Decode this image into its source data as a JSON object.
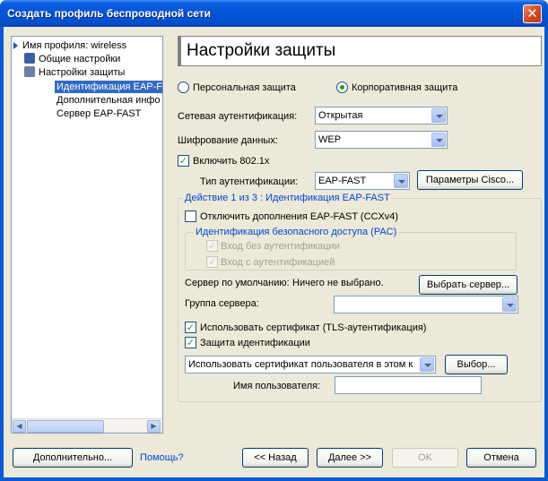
{
  "window": {
    "title": "Создать профиль беспроводной сети"
  },
  "tree": {
    "items": [
      {
        "label": "Имя профиля: wireless"
      },
      {
        "label": "Общие настройки"
      },
      {
        "label": "Настройки защиты"
      },
      {
        "label": "Идентификация EAP-F"
      },
      {
        "label": "Дополнительная инфо"
      },
      {
        "label": "Сервер EAP-FAST"
      }
    ]
  },
  "panel": {
    "title": "Настройки защиты"
  },
  "security": {
    "personal_label": "Персональная защита",
    "enterprise_label": "Корпоративная защита",
    "selected": "enterprise",
    "net_auth_label": "Сетевая аутентификация:",
    "net_auth_value": "Открытая",
    "encryption_label": "Шифрование данных:",
    "encryption_value": "WEP",
    "enable_8021x_label": "Включить 802.1x",
    "enable_8021x_checked": true,
    "auth_type_label": "Тип аутентификации:",
    "auth_type_value": "EAP-FAST",
    "cisco_params_button": "Параметры Cisco..."
  },
  "eap": {
    "group_title": "Действие 1 из 3 : Идентификация EAP-FAST",
    "disable_ccx_label": "Отключить дополнения EAP-FAST (CCXv4)",
    "disable_ccx_checked": false,
    "pac_group_title": "Идентификация безопасного доступа (PAC)",
    "pac_unauth_label": "Вход без аутентификации",
    "pac_auth_label": "Вход с аутентификацией",
    "default_server_label": "Сервер по умолчанию:",
    "default_server_value": "Ничего не выбрано.",
    "select_server_button": "Выбрать сервер...",
    "server_group_label": "Группа сервера:",
    "server_group_value": "",
    "use_cert_label": "Использовать сертификат (TLS-аутентификация)",
    "use_cert_checked": true,
    "identity_protect_label": "Защита идентификации",
    "identity_protect_checked": true,
    "cert_combo_value": "Использовать сертификат пользователя в этом к",
    "choose_button": "Выбор...",
    "username_label": "Имя пользователя:",
    "username_value": ""
  },
  "footer": {
    "advanced_button": "Дополнительно...",
    "help_link": "Помощь?",
    "back_button": "<< Назад",
    "next_button": "Далее >>",
    "ok_button": "OK",
    "cancel_button": "Отмена"
  },
  "colors": {
    "title_bar": "#0353d8",
    "dialog_bg": "#ece9d8",
    "selection": "#316ac5",
    "link": "#0046d5"
  }
}
